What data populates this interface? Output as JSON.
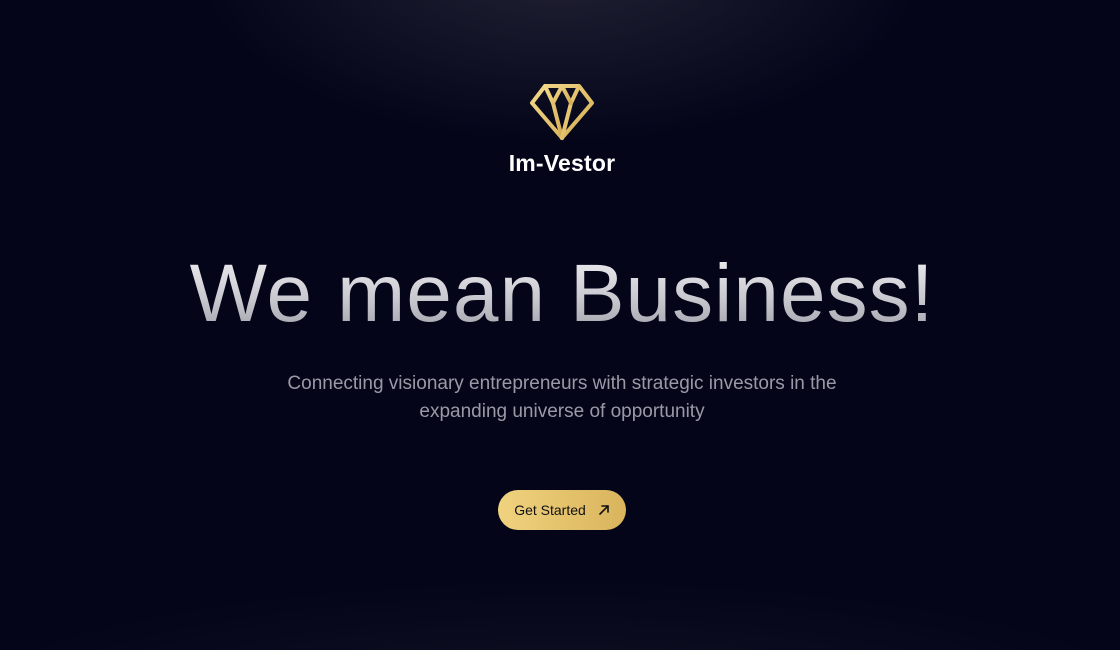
{
  "brand": {
    "name": "Im-Vestor",
    "logo_icon": "diamond-icon",
    "accent_color": "#e8c66e"
  },
  "hero": {
    "headline": "We mean Business!",
    "subtitle_line1": "Connecting visionary entrepreneurs with strategic investors in the",
    "subtitle_line2": "expanding universe of opportunity"
  },
  "cta": {
    "label": "Get Started",
    "icon": "arrow-up-right-icon"
  },
  "colors": {
    "background": "#05051a",
    "button_gradient_start": "#f0d27e",
    "button_gradient_end": "#d9b45c"
  }
}
